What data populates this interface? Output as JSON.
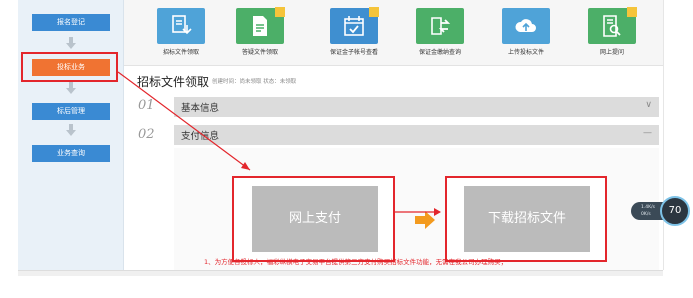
{
  "sidebar": {
    "items": [
      {
        "label": "报名登记"
      },
      {
        "label": "投标业务"
      },
      {
        "label": "标后管理"
      },
      {
        "label": "业务查询"
      }
    ]
  },
  "toolbar": {
    "items": [
      {
        "label": "招标文件领取",
        "icon": "document-receive-icon",
        "color": "#4fa3d8"
      },
      {
        "label": "答疑文件领取",
        "icon": "document-edit-icon",
        "color": "#4caf68"
      },
      {
        "label": "保证金子帐号查看",
        "icon": "calendar-check-icon",
        "color": "#3f8fd0"
      },
      {
        "label": "保证金缴纳查询",
        "icon": "transfer-icon",
        "color": "#4caf68"
      },
      {
        "label": "上传投标文件",
        "icon": "cloud-upload-icon",
        "color": "#4fa3d8"
      },
      {
        "label": "网上提问",
        "icon": "document-search-icon",
        "color": "#4caf68"
      }
    ]
  },
  "page": {
    "title": "招标文件领取",
    "meta": "创建时间：尚未领取   状态：未领取"
  },
  "sections": [
    {
      "num": "01",
      "title": "基本信息",
      "control": "∨"
    },
    {
      "num": "02",
      "title": "支付信息",
      "control": "—"
    }
  ],
  "actions": {
    "pay_label": "网上支付",
    "download_label": "下载招标文件"
  },
  "tip": "1、为方便各投标人，福彩纵横电子交易平台提供第三方支付购买招标文件功能，无需在我公司办理购买；",
  "widget": {
    "up": "1.4K/s",
    "down": "0K/s",
    "percent": "70"
  },
  "colors": {
    "sidebar_btn": "#3a8ad3",
    "sidebar_active": "#f07332",
    "highlight": "#e3262c",
    "arrow_orange": "#f39a1e"
  }
}
